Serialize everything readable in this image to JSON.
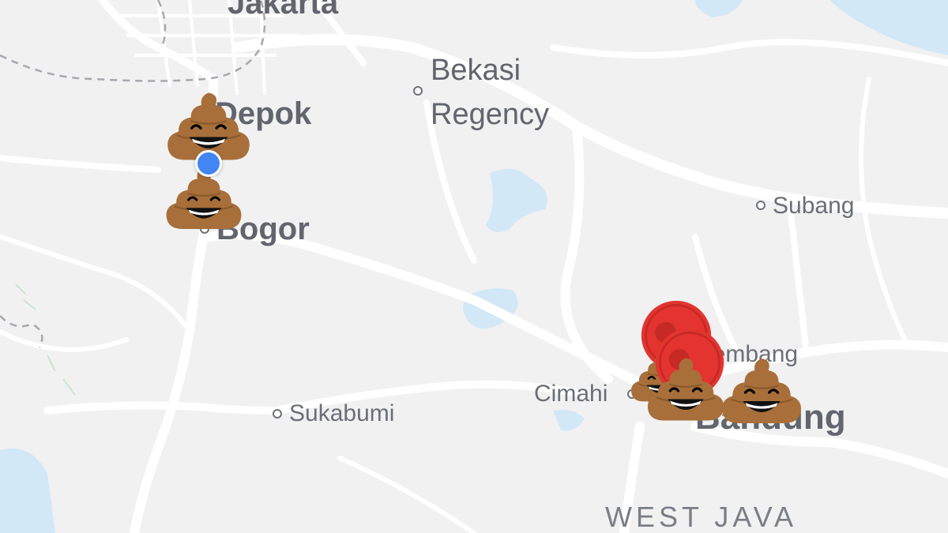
{
  "map": {
    "cities": {
      "jakarta": "Jakarta",
      "depok": "Depok",
      "bekasi_line1": "Bekasi",
      "bekasi_line2": "Regency",
      "bogor": "Bogor",
      "subang": "Subang",
      "lembang": "Lembang",
      "cimahi": "Cimahi",
      "bandung": "Bandung",
      "sukabumi": "Sukabumi"
    },
    "region": "WEST JAVA",
    "markers": {
      "poop_icon": "poop-emoji-icon",
      "pin_icon": "red-location-pin-icon",
      "current_location_icon": "blue-current-location-dot",
      "poop_count": 6,
      "pin_count": 2
    },
    "colors": {
      "background": "#f1f1f2",
      "roads": "#ffffff",
      "water": "#d2e8f6",
      "poop_body": "#a86f3a",
      "pin": "#e3342f",
      "current_location": "#4285f4"
    }
  }
}
